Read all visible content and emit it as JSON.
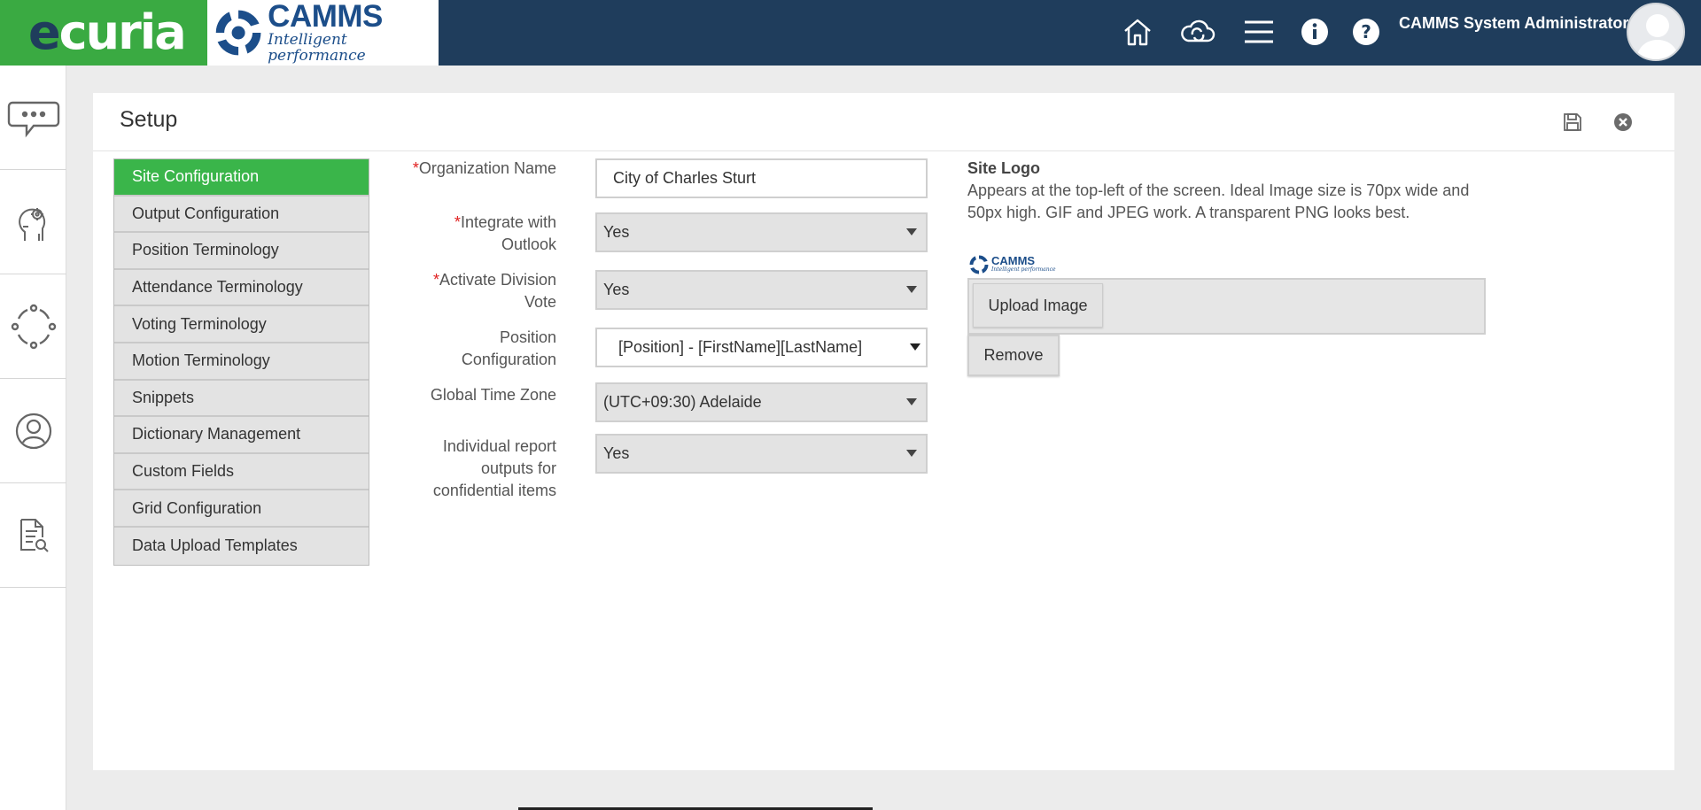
{
  "brand": {
    "ecuria_prefix": "e",
    "ecuria_rest": "curia",
    "camms_name": "CAMMS",
    "camms_tagline": "Intelligent performance"
  },
  "topbar": {
    "icons": [
      "home-icon",
      "cloud-sync-icon",
      "menu-icon",
      "info-icon",
      "help-icon"
    ],
    "user_name": "CAMMS System Administrator"
  },
  "rail": {
    "icons": [
      "chat-icon",
      "settings-person-icon",
      "cycle-icon",
      "user-icon",
      "document-search-icon"
    ]
  },
  "page": {
    "title": "Setup",
    "header_icons": [
      "save-icon",
      "close-icon"
    ]
  },
  "side_menu": {
    "items": [
      {
        "label": "Site Configuration",
        "active": true
      },
      {
        "label": "Output Configuration",
        "active": false
      },
      {
        "label": "Position Terminology",
        "active": false
      },
      {
        "label": "Attendance Terminology",
        "active": false
      },
      {
        "label": "Voting Terminology",
        "active": false
      },
      {
        "label": "Motion Terminology",
        "active": false
      },
      {
        "label": "Snippets",
        "active": false
      },
      {
        "label": "Dictionary Management",
        "active": false
      },
      {
        "label": "Custom Fields",
        "active": false
      },
      {
        "label": "Grid Configuration",
        "active": false
      },
      {
        "label": "Data Upload Templates",
        "active": false
      }
    ]
  },
  "form": {
    "org_name": {
      "required": "*",
      "label": "Organization Name",
      "value": "City of Charles Sturt"
    },
    "outlook": {
      "required": "*",
      "label_line1": "Integrate with",
      "label_line2": "Outlook",
      "value": "Yes"
    },
    "division_vote": {
      "required": "*",
      "label_line1": "Activate Division",
      "label_line2": "Vote",
      "value": "Yes"
    },
    "position_config": {
      "label_line1": "Position",
      "label_line2": "Configuration",
      "value": "[Position] - [FirstName][LastName]"
    },
    "time_zone": {
      "label": "Global Time Zone",
      "value": "(UTC+09:30) Adelaide"
    },
    "individual_report": {
      "label_line1": "Individual report",
      "label_line2": "outputs for",
      "label_line3": "confidential items",
      "value": "Yes"
    }
  },
  "site_logo": {
    "title": "Site Logo",
    "description": "Appears at the top-left of the screen. Ideal Image size is 70px wide and 50px high. GIF and JPEG work. A transparent PNG looks best.",
    "preview_name": "CAMMS",
    "preview_tagline": "Intelligent performance",
    "upload_label": "Upload Image",
    "remove_label": "Remove"
  },
  "colors": {
    "topbar": "#1f3d5c",
    "ecuria_green": "#3aaa42",
    "active_menu": "#3ab54a",
    "required": "#e02020"
  }
}
